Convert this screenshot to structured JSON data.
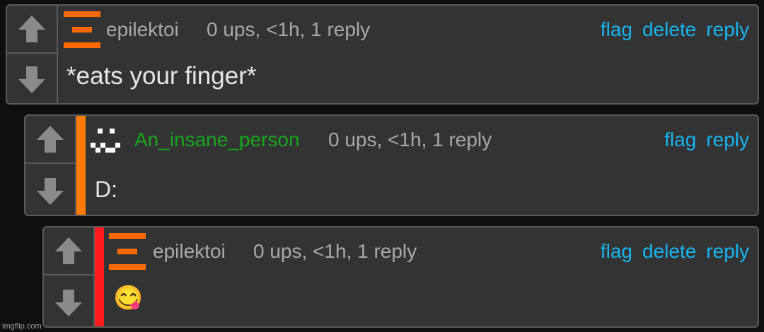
{
  "comments": [
    {
      "username": "epilektoi",
      "meta": "0 ups, <1h, 1 reply",
      "actions": [
        "flag",
        "delete",
        "reply"
      ],
      "body": "*eats your finger*",
      "avatar": "orange-bars-icon"
    },
    {
      "username": "An_insane_person",
      "meta": "0 ups, <1h, 1 reply",
      "actions": [
        "flag",
        "reply"
      ],
      "body": "D:",
      "avatar": "pixel-face-icon",
      "depth_color": "#ff7b00"
    },
    {
      "username": "epilektoi",
      "meta": "0 ups, <1h, 1 reply",
      "actions": [
        "flag",
        "delete",
        "reply"
      ],
      "body": "😋",
      "avatar": "orange-bars-icon",
      "depth_color": "#ff1b1b"
    }
  ],
  "colors": {
    "link": "#16b4ef",
    "username_green": "#16a61d",
    "avatar_orange": "#ff6a00"
  },
  "watermark": "imgflip.com"
}
